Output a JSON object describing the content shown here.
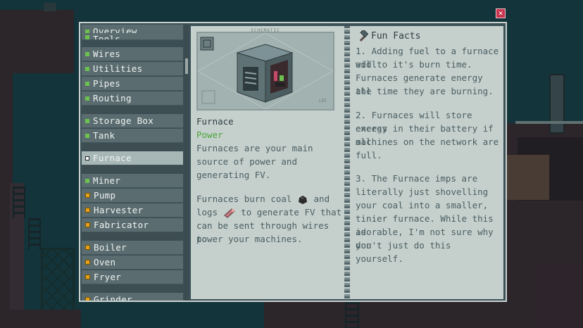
{
  "close_label": "✕",
  "sidebar": {
    "items": [
      {
        "label": "Overview",
        "icon": "green-square"
      },
      {
        "label": "Tools",
        "icon": "green-square"
      },
      {
        "label": "Wires",
        "icon": "green-square"
      },
      {
        "label": "Utilities",
        "icon": "green-square"
      },
      {
        "label": "Pipes",
        "icon": "green-square"
      },
      {
        "label": "Routing",
        "icon": "green-square"
      },
      {
        "label": "Storage Box",
        "icon": "green-square"
      },
      {
        "label": "Tank",
        "icon": "green-square"
      },
      {
        "label": "Furnace",
        "icon": "white-square",
        "active": true
      },
      {
        "label": "Miner",
        "icon": "green-square"
      },
      {
        "label": "Pump",
        "icon": "orange-square"
      },
      {
        "label": "Harvester",
        "icon": "orange-square"
      },
      {
        "label": "Fabricator",
        "icon": "orange-square"
      },
      {
        "label": "Boiler",
        "icon": "orange-square"
      },
      {
        "label": "Oven",
        "icon": "orange-square"
      },
      {
        "label": "Fryer",
        "icon": "orange-square"
      },
      {
        "label": "Grinder",
        "icon": "orange-square"
      }
    ]
  },
  "left_page": {
    "schematic_label": "SCHEMATIC",
    "title": "Furnace",
    "category": "Power",
    "description": [
      "Furnaces are your main",
      "source of power and",
      "generating FV."
    ],
    "burn_line1_pre": "Furnaces burn coal",
    "burn_line1_post": "and",
    "burn_line2_pre": "logs",
    "burn_line2_post": "to generate FV that",
    "burn_line3": "can be sent through wires to",
    "burn_line4": "power your machines."
  },
  "right_page": {
    "title": "Fun Facts",
    "facts": [
      [
        "1. Adding fuel to a furnace will",
        "add to it's burn time.",
        "Furnaces generate energy all",
        "the time they are burning."
      ],
      [
        "2. Furnaces will store excess",
        "energy in their battery if all",
        "machines on the network are",
        "full."
      ],
      [
        "3. The Furnace imps are",
        "literally just shovelling",
        "your coal into a smaller,",
        "tinier furnace. While this is",
        "adorable, I'm not sure why you",
        "don't just do this yourself."
      ]
    ]
  },
  "colors": {
    "accent_green": "#4aa53a",
    "close_red": "#c8324c",
    "page": "#c5d0cd"
  }
}
